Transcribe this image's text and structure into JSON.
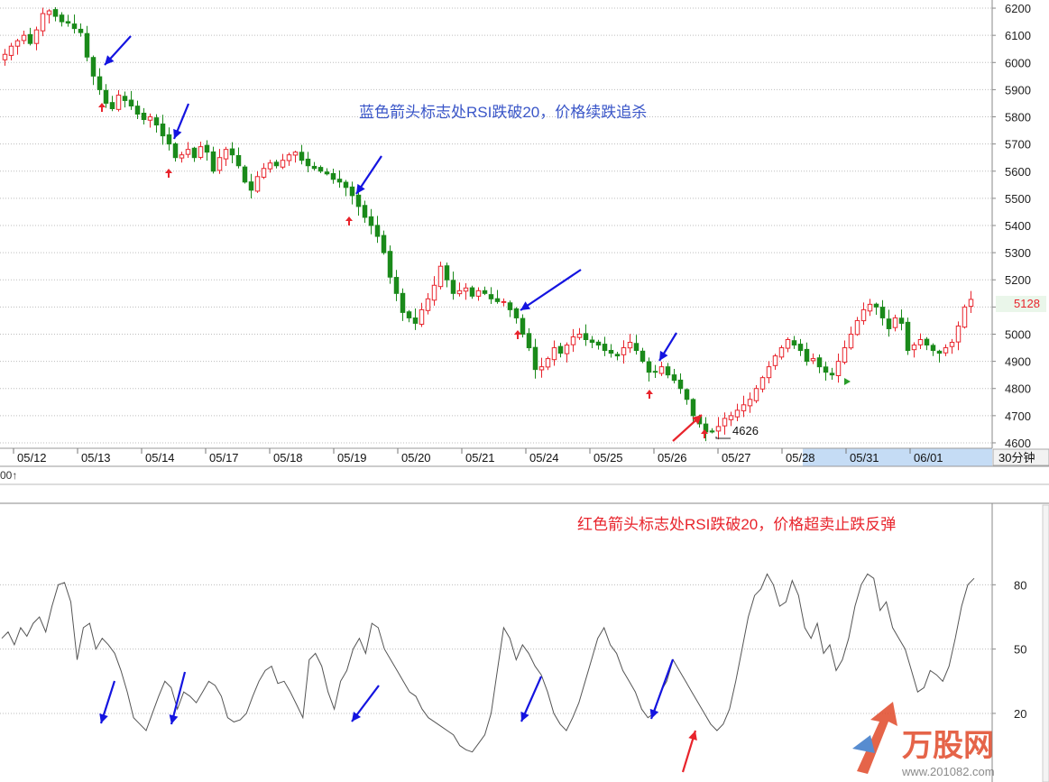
{
  "chart_data": [
    {
      "type": "candlestick",
      "period_label": "30分钟",
      "y_ticks": [
        6200,
        6100,
        6000,
        5900,
        5800,
        5700,
        5600,
        5500,
        5400,
        5300,
        5200,
        5100,
        5000,
        4900,
        4800,
        4700,
        4600
      ],
      "ylim": [
        4580,
        6230
      ],
      "date_labels": [
        "05/12",
        "05/13",
        "05/14",
        "05/17",
        "05/18",
        "05/19",
        "05/20",
        "05/21",
        "05/24",
        "05/25",
        "05/26",
        "05/27",
        "05/28",
        "05/31",
        "06/01"
      ],
      "highlighted_date": "05/28",
      "last_price": "5128",
      "low_label": "4626",
      "annotation": "蓝色箭头标志处RSI跌破20，价格续跌追杀",
      "up_color": "#e8242c",
      "down_color": "#1a8a1a",
      "close_series": [
        6030,
        6060,
        6080,
        6100,
        6070,
        6120,
        6180,
        6190,
        6170,
        6150,
        6145,
        6125,
        6110,
        6020,
        5950,
        5900,
        5850,
        5830,
        5880,
        5860,
        5840,
        5810,
        5790,
        5800,
        5770,
        5730,
        5700,
        5650,
        5660,
        5680,
        5650,
        5690,
        5670,
        5600,
        5650,
        5680,
        5660,
        5620,
        5560,
        5530,
        5580,
        5610,
        5630,
        5620,
        5640,
        5660,
        5670,
        5640,
        5620,
        5610,
        5600,
        5590,
        5570,
        5560,
        5540,
        5510,
        5470,
        5430,
        5400,
        5360,
        5300,
        5210,
        5150,
        5080,
        5060,
        5040,
        5090,
        5130,
        5180,
        5250,
        5200,
        5150,
        5160,
        5170,
        5140,
        5160,
        5150,
        5130,
        5120,
        5120,
        5090,
        5060,
        5000,
        4950,
        4870,
        4880,
        4910,
        4950,
        4930,
        4960,
        4990,
        5000,
        4980,
        4970,
        4960,
        4940,
        4930,
        4920,
        4950,
        4970,
        4940,
        4900,
        4860,
        4860,
        4880,
        4850,
        4830,
        4800,
        4760,
        4700,
        4670,
        4640,
        4640,
        4660,
        4690,
        4700,
        4720,
        4740,
        4760,
        4800,
        4840,
        4880,
        4920,
        4950,
        4980,
        4960,
        4940,
        4900,
        4910,
        4880,
        4860,
        4850,
        4900,
        4950,
        5000,
        5050,
        5090,
        5110,
        5100,
        5060,
        5020,
        5060,
        5040,
        4940,
        4960,
        4980,
        4960,
        4940,
        4930,
        4950,
        4970,
        5030,
        5100,
        5128
      ]
    },
    {
      "type": "line",
      "y_ticks": [
        80,
        50,
        20
      ],
      "ylim": [
        0,
        100
      ],
      "annotation": "红色箭头标志处RSI跌破20，价格超卖止跌反弹",
      "top_left_fragment": "00↑",
      "values": [
        55,
        58,
        52,
        60,
        56,
        62,
        65,
        58,
        70,
        80,
        81,
        72,
        45,
        60,
        62,
        50,
        55,
        52,
        48,
        40,
        30,
        18,
        15,
        12,
        20,
        28,
        35,
        32,
        22,
        30,
        28,
        25,
        30,
        35,
        33,
        28,
        18,
        16,
        17,
        20,
        28,
        35,
        40,
        42,
        34,
        35,
        30,
        24,
        18,
        45,
        48,
        42,
        30,
        22,
        35,
        40,
        50,
        55,
        48,
        62,
        60,
        50,
        45,
        40,
        35,
        30,
        28,
        22,
        18,
        16,
        14,
        12,
        10,
        5,
        3,
        2,
        6,
        10,
        20,
        40,
        60,
        55,
        45,
        52,
        48,
        42,
        38,
        30,
        20,
        15,
        12,
        18,
        25,
        35,
        45,
        55,
        60,
        52,
        48,
        40,
        35,
        30,
        22,
        18,
        20,
        30,
        35,
        45,
        40,
        35,
        30,
        25,
        20,
        15,
        12,
        15,
        22,
        35,
        50,
        65,
        75,
        78,
        85,
        80,
        70,
        72,
        82,
        75,
        60,
        55,
        62,
        48,
        52,
        40,
        45,
        55,
        70,
        80,
        85,
        83,
        68,
        72,
        60,
        55,
        50,
        40,
        30,
        32,
        40,
        38,
        35,
        42,
        55,
        70,
        80,
        83
      ]
    }
  ],
  "watermark": "万股网",
  "watermark_url": "www.201082.com"
}
